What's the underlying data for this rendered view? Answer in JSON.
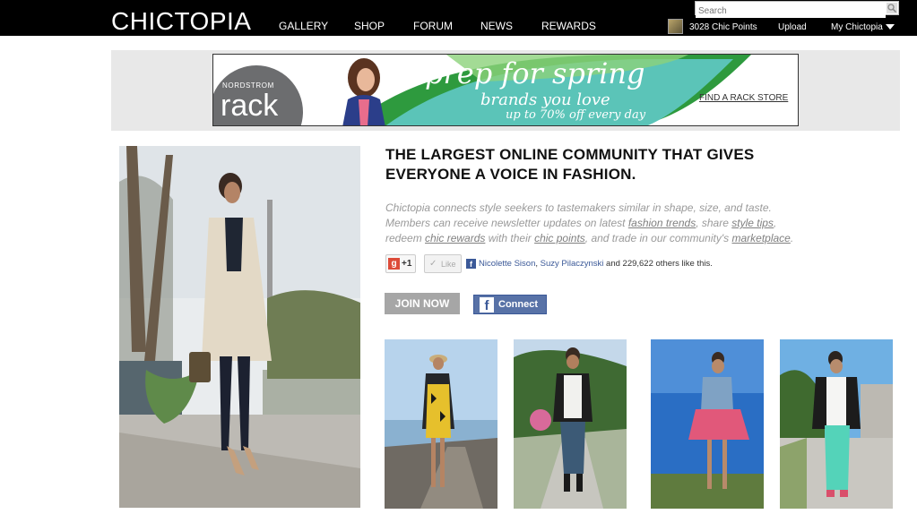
{
  "header": {
    "logo": "CHICTOPIA",
    "nav": [
      "GALLERY",
      "SHOP",
      "FORUM",
      "NEWS",
      "REWARDS"
    ],
    "search_placeholder": "Search",
    "chic_points": "3028 Chic Points",
    "upload": "Upload",
    "my_chictopia": "My Chictopia"
  },
  "ad": {
    "brand_small": "NORDSTROM",
    "brand_big": "rack",
    "headline": "prep for spring",
    "subhead": "brands you love",
    "offer": "up to 70% off every day",
    "cta": "FIND A RACK STORE"
  },
  "main": {
    "headline_1": "THE LARGEST ONLINE COMMUNITY THAT GIVES",
    "headline_2": "EVERYONE A VOICE IN FASHION.",
    "desc": {
      "line1": "Chictopia connects style seekers to tastemakers similar in shape, size, and taste.",
      "l2a": "Members can receive newsletter updates on latest ",
      "fashion_trends": "fashion trends",
      "l2b": ", share ",
      "style_tips": "style tips",
      "l2c": ",",
      "l3a": "redeem ",
      "chic_rewards": "chic rewards",
      "l3b": " with their ",
      "chic_points": "chic points",
      "l3c": ", and trade in our community's ",
      "marketplace": "marketplace",
      "l3d": "."
    },
    "social": {
      "gplus_g": "g",
      "gplus": "+1",
      "like_check": "✓",
      "like": "Like",
      "fb_f": "f",
      "friend1": "Nicolette Sison",
      "sep": ", ",
      "friend2": "Suzy Pilaczynski",
      "rest": " and 229,622 others like this."
    },
    "join_label": "JOIN NOW",
    "connect_f": "f",
    "connect_label": "Connect"
  },
  "colors": {
    "topbar": "#000000",
    "ad_teal": "#5bc4b8",
    "ad_green": "#2e9a3e",
    "join_gray": "#a6a6a6",
    "facebook": "#3b5998"
  }
}
